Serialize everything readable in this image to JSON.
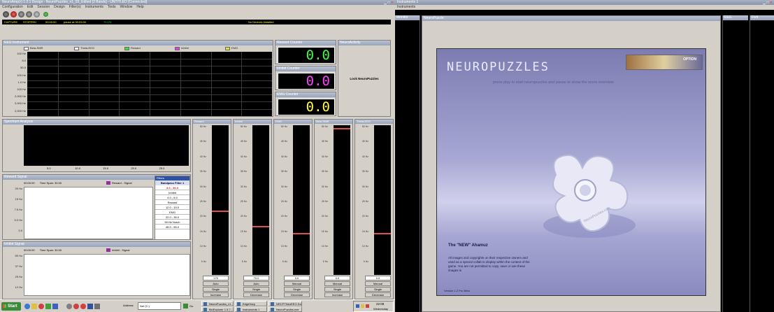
{
  "left_window": {
    "title": "NeuroAmp(r) 1.2.1 Design - NeuroPuzzles_v1_03_Edited [2 Bands] - UNTITLED [Connected]",
    "menu": [
      "Configuration",
      "Edit",
      "Session",
      "Design",
      "Filter(s)",
      "Instruments",
      "Tools",
      "Window",
      "Help"
    ],
    "status": {
      "capture": "CAPTURE",
      "stopped": "STOPPED",
      "time": "00:00:00",
      "msg": "pause at 00:03:00",
      "pct": "70.1%",
      "device": "No Devices Installed"
    },
    "eeg_panel": {
      "title": "EEG Instrument",
      "legend": [
        "Beta-SMR",
        "Theta-EEG",
        "Reward",
        "Inhibit",
        "EMG"
      ],
      "legend_colors": [
        "#ffffff",
        "#ffffff",
        "#40e040",
        "#e040e0",
        "#e0e040"
      ],
      "yticks": [
        "100 Hz",
        "8.0",
        "50.0",
        "100 Hz",
        "1.0 Hz",
        "100 Hz",
        "2,000 Hz",
        "2,000 Hz",
        "2,000 Hz"
      ]
    },
    "numeric_panels": [
      {
        "title": "Reward Counter",
        "value": "0.0",
        "color": "#40ff40"
      },
      {
        "title": "Inhibit Counter",
        "value": "0.0",
        "color": "#ff40ff"
      },
      {
        "title": "EMG Counter",
        "value": "0.0",
        "color": "#ffff40"
      }
    ],
    "action_panel": {
      "title": "NeuroActivity",
      "label": "Lock NeuroPuzzles"
    },
    "spectrum_panel": {
      "title": "Spectrum Analysis",
      "xticks": [
        "5.0",
        "10.0",
        "15.0",
        "20.0",
        "25.0"
      ]
    },
    "reward_signal": {
      "title": "Reward Signal",
      "time": "00:00:00",
      "span": "Time Span: 30.00",
      "legend": "Reward - Signal",
      "yticks": [
        "20 Hz",
        "15 Hz",
        "7.5 Hz",
        "5.0 Hz",
        "0.0"
      ]
    },
    "filters": {
      "title": "Filters",
      "header": "Bandpass Filter 1",
      "rows": [
        "3.0 - 36.0",
        "Inhibit",
        "4.0 - 8.0",
        "Reward",
        "12.0 - 15.0",
        "EMG",
        "22.0 - 36.0",
        "50 Hz Notch",
        "45.0 - 55.0"
      ]
    },
    "inhibit_signal": {
      "title": "Inhibit Signal",
      "time": "00:00:00",
      "span": "Time Span: 30.00",
      "legend": "Inhibit - Signal",
      "yticks": [
        "50 Hz",
        "37 Hz",
        "25 Hz",
        "12 Hz"
      ]
    },
    "meters": [
      {
        "title": "Reward",
        "value": "175",
        "mode": "Auto",
        "single": "Single",
        "increase": "Increase",
        "threshold": 0.42,
        "fill": 0.0
      },
      {
        "title": "Inhibit",
        "value": "70.0",
        "mode": "Auto",
        "single": "Single",
        "increase": "Decrease",
        "threshold": 0.32,
        "fill": 0.0
      },
      {
        "title": "EMG",
        "value": "0.0",
        "mode": "Manual",
        "single": "Single",
        "increase": "Decrease",
        "threshold": 0.27,
        "fill": 0.0
      },
      {
        "title": "Beta-SMR",
        "value": "0.0",
        "mode": "Manual",
        "single": "Single",
        "increase": "Increase",
        "threshold": 0.97,
        "fill": 0.0
      },
      {
        "title": "Theta-EEG",
        "value": "0.0",
        "mode": "Manual",
        "single": "Single",
        "increase": "Decrease",
        "threshold": 0.27,
        "fill": 0.0
      }
    ],
    "meter_ticks": [
      "50 Hz",
      "45 Hz",
      "40 Hz",
      "35 Hz",
      "30 Hz",
      "25 Hz",
      "20 Hz",
      "15 Hz",
      "10 Hz",
      "5 Hz"
    ]
  },
  "taskbar": {
    "start": "Start",
    "address_label": "Address",
    "address_value": "Net (C:)",
    "go": "Go",
    "tasks": [
      "NeuroPuzzles_v1...",
      "EdgeHarp",
      "NRCPTNeoEEG Do...",
      "BioExplorer 1.5.7...",
      "Instruments 1",
      "NeuroPuzzles.exe"
    ],
    "clock_time": "22:08",
    "clock_day": "Wednesday"
  },
  "right_window": {
    "title": "Instruments 1",
    "menu": "Instruments",
    "side_left": "Monitor",
    "panel_title": "NeuroPuzzle",
    "side_right_1": "EEG",
    "side_right_2": "Fixit",
    "game": {
      "logo": "NEUROPUZZLES",
      "option": "OPTION",
      "subtitle": "press play to start neuropuzzles and pause to show the score overview",
      "piece_name": "The \"NEW\" Ahamuz",
      "desc": "All images and copyrights on their respective owners and used as a special collab to display within the context of the game. You are not permitted to copy, save or use these images in",
      "version": "Version 1.2 Pro Beta",
      "watermark": "NeuroPuzzles.com"
    }
  }
}
